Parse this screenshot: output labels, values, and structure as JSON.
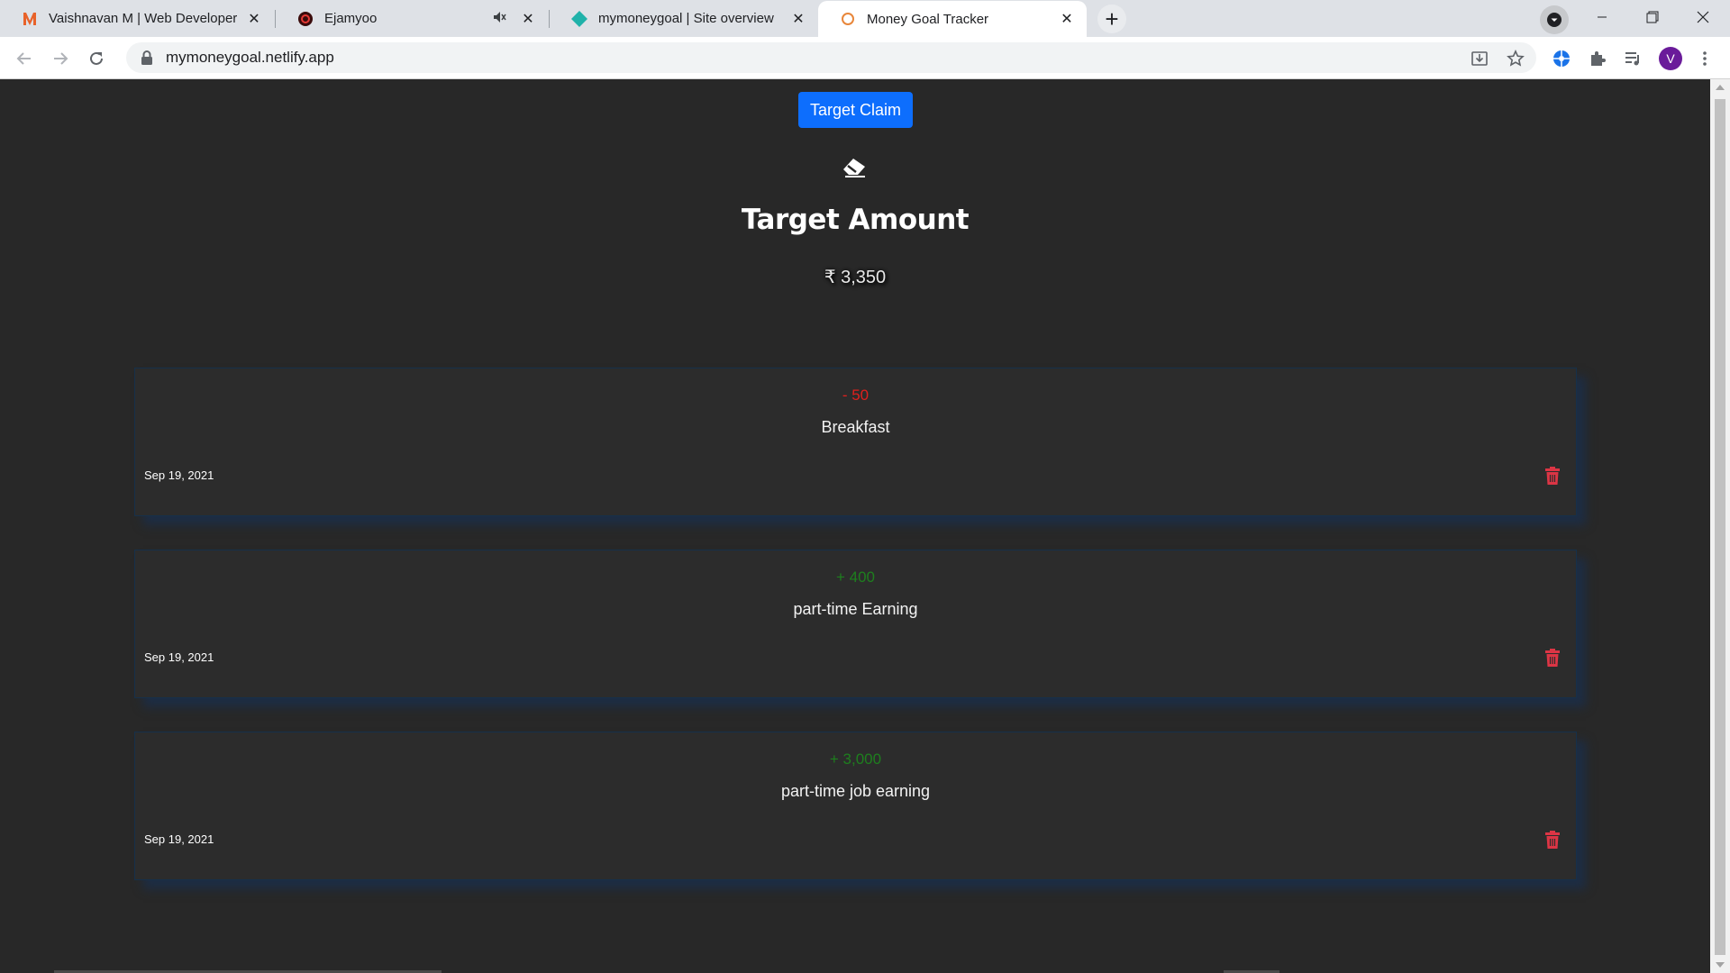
{
  "browser": {
    "tabs": [
      {
        "title": "Vaishnavan M | Web Developer",
        "favicon": "m-logo-icon",
        "active": false
      },
      {
        "title": "Ejamyoo",
        "favicon": "ejamyoo-icon",
        "active": false,
        "muted": true
      },
      {
        "title": "mymoneygoal | Site overview",
        "favicon": "netlify-icon",
        "active": false
      },
      {
        "title": "Money Goal Tracker",
        "favicon": "globe-icon",
        "active": true
      }
    ],
    "url": "mymoneygoal.netlify.app",
    "profile_initial": "V",
    "colors": {
      "profile": "#6a1b9a",
      "tabstrip": "#dee1e6"
    }
  },
  "page": {
    "claim_button": "Target Claim",
    "title": "Target Amount",
    "amount": "₹ 3,350",
    "colors": {
      "button": "#0d6efd",
      "negative": "#e0201d",
      "positive": "#1e7f1e",
      "background": "#282828",
      "trash": "#dc3545"
    }
  },
  "transactions": [
    {
      "amount": "- 50",
      "sign": "negative",
      "description": "Breakfast",
      "date": "Sep 19, 2021"
    },
    {
      "amount": "+ 400",
      "sign": "positive",
      "description": "part-time Earning",
      "date": "Sep 19, 2021"
    },
    {
      "amount": "+ 3,000",
      "sign": "positive",
      "description": "part-time job earning",
      "date": "Sep 19, 2021"
    }
  ]
}
